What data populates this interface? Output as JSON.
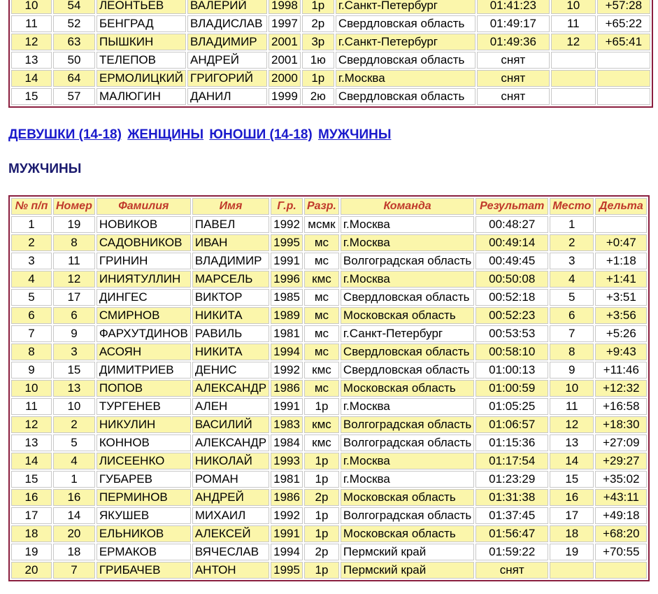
{
  "top_table": {
    "rows": [
      [
        "10",
        "54",
        "ЛЕОНТЬЕВ",
        "ВАЛЕРИЙ",
        "1998",
        "1р",
        "г.Санкт-Петербург",
        "01:41:23",
        "10",
        "+57:28"
      ],
      [
        "11",
        "52",
        "БЕНГРАД",
        "ВЛАДИСЛАВ",
        "1997",
        "2р",
        "Свердловская область",
        "01:49:17",
        "11",
        "+65:22"
      ],
      [
        "12",
        "63",
        "ПЫШКИН",
        "ВЛАДИМИР",
        "2001",
        "3р",
        "г.Санкт-Петербург",
        "01:49:36",
        "12",
        "+65:41"
      ],
      [
        "13",
        "50",
        "ТЕЛЕПОВ",
        "АНДРЕЙ",
        "2001",
        "1ю",
        "Свердловская область",
        "снят",
        "",
        ""
      ],
      [
        "14",
        "64",
        "ЕРМОЛИЦКИЙ",
        "ГРИГОРИЙ",
        "2000",
        "1р",
        "г.Москва",
        "снят",
        "",
        ""
      ],
      [
        "15",
        "57",
        "МАЛЮГИН",
        "ДАНИЛ",
        "1999",
        "2ю",
        "Свердловская область",
        "снят",
        "",
        ""
      ]
    ]
  },
  "nav": {
    "links": [
      "ДЕВУШКИ (14-18)",
      "ЖЕНЩИНЫ",
      "ЮНОШИ (14-18)",
      "МУЖЧИНЫ"
    ]
  },
  "section": {
    "title": "МУЖЧИНЫ"
  },
  "main_table": {
    "headers": [
      "№ п/п",
      "Номер",
      "Фамилия",
      "Имя",
      "Г.р.",
      "Разр.",
      "Команда",
      "Результат",
      "Место",
      "Дельта"
    ],
    "rows": [
      [
        "1",
        "19",
        "НОВИКОВ",
        "ПАВЕЛ",
        "1992",
        "мсмк",
        "г.Москва",
        "00:48:27",
        "1",
        ""
      ],
      [
        "2",
        "8",
        "САДОВНИКОВ",
        "ИВАН",
        "1995",
        "мс",
        "г.Москва",
        "00:49:14",
        "2",
        "+0:47"
      ],
      [
        "3",
        "11",
        "ГРИНИН",
        "ВЛАДИМИР",
        "1991",
        "мс",
        "Волгоградская область",
        "00:49:45",
        "3",
        "+1:18"
      ],
      [
        "4",
        "12",
        "ИНИЯТУЛЛИН",
        "МАРСЕЛЬ",
        "1996",
        "кмс",
        "г.Москва",
        "00:50:08",
        "4",
        "+1:41"
      ],
      [
        "5",
        "17",
        "ДИНГЕС",
        "ВИКТОР",
        "1985",
        "мс",
        "Свердловская область",
        "00:52:18",
        "5",
        "+3:51"
      ],
      [
        "6",
        "6",
        "СМИРНОВ",
        "НИКИТА",
        "1989",
        "мс",
        "Московская область",
        "00:52:23",
        "6",
        "+3:56"
      ],
      [
        "7",
        "9",
        "ФАРХУТДИНОВ",
        "РАВИЛЬ",
        "1981",
        "мс",
        "г.Санкт-Петербург",
        "00:53:53",
        "7",
        "+5:26"
      ],
      [
        "8",
        "3",
        "АСОЯН",
        "НИКИТА",
        "1994",
        "мс",
        "Свердловская область",
        "00:58:10",
        "8",
        "+9:43"
      ],
      [
        "9",
        "15",
        "ДИМИТРИЕВ",
        "ДЕНИС",
        "1992",
        "кмс",
        "Свердловская область",
        "01:00:13",
        "9",
        "+11:46"
      ],
      [
        "10",
        "13",
        "ПОПОВ",
        "АЛЕКСАНДР",
        "1986",
        "мс",
        "Московская область",
        "01:00:59",
        "10",
        "+12:32"
      ],
      [
        "11",
        "10",
        "ТУРГЕНЕВ",
        "АЛЕН",
        "1991",
        "1р",
        "г.Москва",
        "01:05:25",
        "11",
        "+16:58"
      ],
      [
        "12",
        "2",
        "НИКУЛИН",
        "ВАСИЛИЙ",
        "1983",
        "кмс",
        "Волгоградская область",
        "01:06:57",
        "12",
        "+18:30"
      ],
      [
        "13",
        "5",
        "КОННОВ",
        "АЛЕКСАНДР",
        "1984",
        "кмс",
        "Волгоградская область",
        "01:15:36",
        "13",
        "+27:09"
      ],
      [
        "14",
        "4",
        "ЛИСЕЕНКО",
        "НИКОЛАЙ",
        "1993",
        "1р",
        "г.Москва",
        "01:17:54",
        "14",
        "+29:27"
      ],
      [
        "15",
        "1",
        "ГУБАРЕВ",
        "РОМАН",
        "1981",
        "1р",
        "г.Москва",
        "01:23:29",
        "15",
        "+35:02"
      ],
      [
        "16",
        "16",
        "ПЕРМИНОВ",
        "АНДРЕЙ",
        "1986",
        "2р",
        "Московская область",
        "01:31:38",
        "16",
        "+43:11"
      ],
      [
        "17",
        "14",
        "ЯКУШЕВ",
        "МИХАИЛ",
        "1992",
        "1р",
        "Волгоградская область",
        "01:37:45",
        "17",
        "+49:18"
      ],
      [
        "18",
        "20",
        "ЕЛЬНИКОВ",
        "АЛЕКСЕЙ",
        "1991",
        "1р",
        "Московская область",
        "01:56:47",
        "18",
        "+68:20"
      ],
      [
        "19",
        "18",
        "ЕРМАКОВ",
        "ВЯЧЕСЛАВ",
        "1994",
        "2р",
        "Пермский край",
        "01:59:22",
        "19",
        "+70:55"
      ],
      [
        "20",
        "7",
        "ГРИБАЧЕВ",
        "АНТОН",
        "1995",
        "1р",
        "Пермский край",
        "снят",
        "",
        ""
      ]
    ]
  },
  "colors": {
    "row_alt": "#fbf6ab",
    "border": "#8b1f3f",
    "header_text": "#c0392b",
    "link": "#1a1acc",
    "title": "#1a1a6e"
  }
}
